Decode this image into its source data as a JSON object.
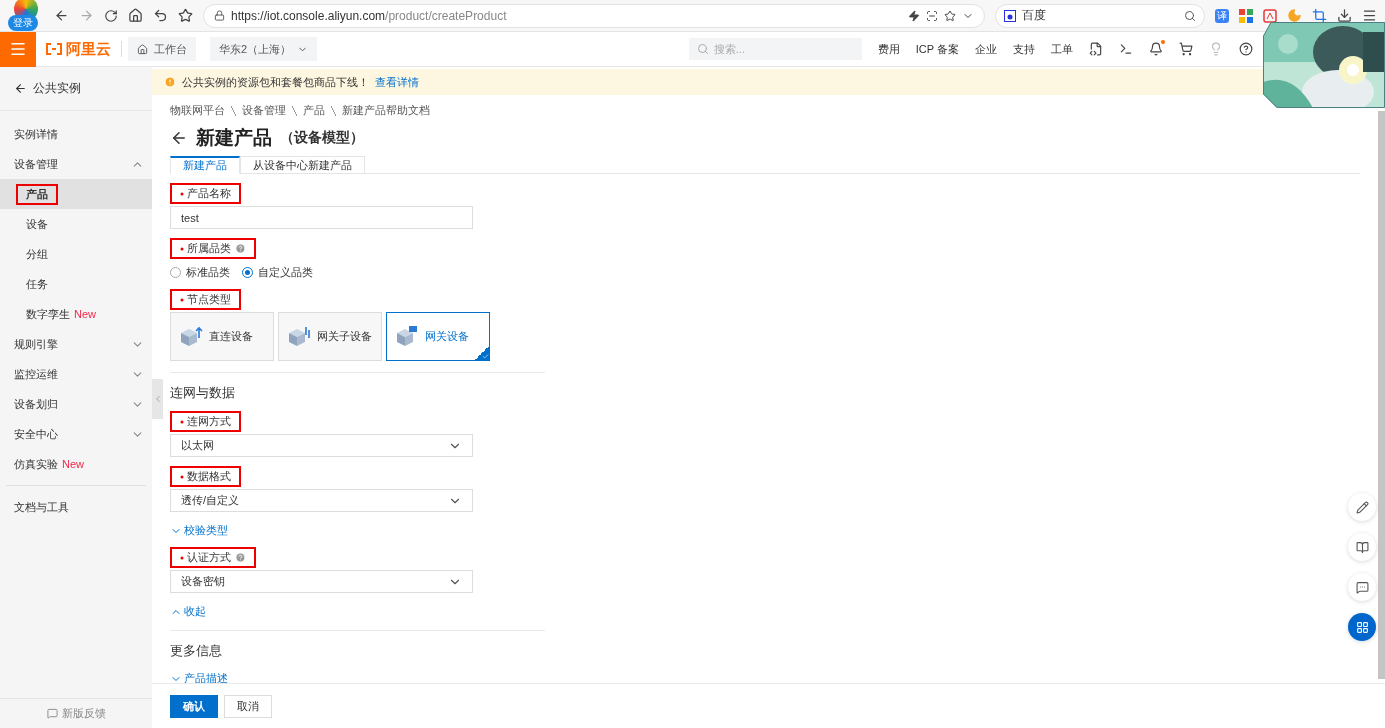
{
  "browser": {
    "login_badge": "登录",
    "url_host": "https://iot.console.aliyun.com",
    "url_path": "/product/createProduct",
    "search_engine": "百度",
    "translate": "译"
  },
  "header": {
    "logo": "阿里云",
    "workbench": "工作台",
    "region": "华东2（上海）",
    "search_placeholder": "搜索...",
    "links": [
      "费用",
      "ICP 备案",
      "企业",
      "支持",
      "工单"
    ],
    "notification_dot": true
  },
  "sidebar": {
    "back": "公共实例",
    "items": [
      {
        "label": "实例详情",
        "kind": "item"
      },
      {
        "label": "设备管理",
        "kind": "group",
        "expanded": true,
        "children": [
          {
            "label": "产品",
            "selected": true,
            "highlighted": true
          },
          {
            "label": "设备",
            "selected": false,
            "highlighted": false
          },
          {
            "label": "分组",
            "selected": false,
            "highlighted": false
          },
          {
            "label": "任务",
            "selected": false,
            "highlighted": false
          },
          {
            "label": "数字孪生",
            "badge": "New",
            "selected": false,
            "highlighted": false
          }
        ]
      },
      {
        "label": "规则引擎",
        "kind": "group",
        "expanded": false
      },
      {
        "label": "监控运维",
        "kind": "group",
        "expanded": false
      },
      {
        "label": "设备划归",
        "kind": "group",
        "expanded": false
      },
      {
        "label": "安全中心",
        "kind": "group",
        "expanded": false
      },
      {
        "label": "仿真实验",
        "kind": "item",
        "badge": "New"
      }
    ],
    "docs": "文档与工具",
    "feedback": "新版反馈"
  },
  "notice": {
    "text": "公共实例的资源包和套餐包商品下线！",
    "link": "查看详情"
  },
  "breadcrumb": [
    "物联网平台",
    "设备管理",
    "产品",
    "新建产品帮助文档"
  ],
  "title": "新建产品",
  "subtitle": "（设备模型）",
  "tabs": [
    {
      "label": "新建产品",
      "selected": true
    },
    {
      "label": "从设备中心新建产品",
      "selected": false
    }
  ],
  "form": [
    {
      "kind": "text",
      "label": "产品名称",
      "required": true,
      "highlighted": true,
      "value": "test"
    },
    {
      "kind": "radio",
      "label": "所属品类",
      "required": true,
      "highlighted": true,
      "help": true,
      "options": [
        {
          "label": "标准品类",
          "selected": false
        },
        {
          "label": "自定义品类",
          "selected": true
        }
      ]
    },
    {
      "kind": "cards",
      "label": "节点类型",
      "required": true,
      "highlighted": true,
      "options": [
        {
          "label": "直连设备",
          "selected": false
        },
        {
          "label": "网关子设备",
          "selected": false
        },
        {
          "label": "网关设备",
          "selected": true
        }
      ]
    },
    {
      "kind": "section",
      "label": "连网与数据"
    },
    {
      "kind": "select",
      "label": "连网方式",
      "required": true,
      "highlighted": true,
      "value": "以太网"
    },
    {
      "kind": "select",
      "label": "数据格式",
      "required": true,
      "highlighted": true,
      "value": "透传/自定义"
    },
    {
      "kind": "toggle",
      "label": "校验类型",
      "expanded": false
    },
    {
      "kind": "select",
      "label": "认证方式",
      "required": true,
      "highlighted": true,
      "help": true,
      "value": "设备密钥"
    },
    {
      "kind": "toggle",
      "label": "收起",
      "expanded": true
    },
    {
      "kind": "section",
      "label": "更多信息"
    },
    {
      "kind": "toggle",
      "label": "产品描述",
      "expanded": false
    }
  ],
  "footer": [
    {
      "label": "确认",
      "kind": "primary"
    },
    {
      "label": "取消",
      "kind": "default"
    }
  ]
}
